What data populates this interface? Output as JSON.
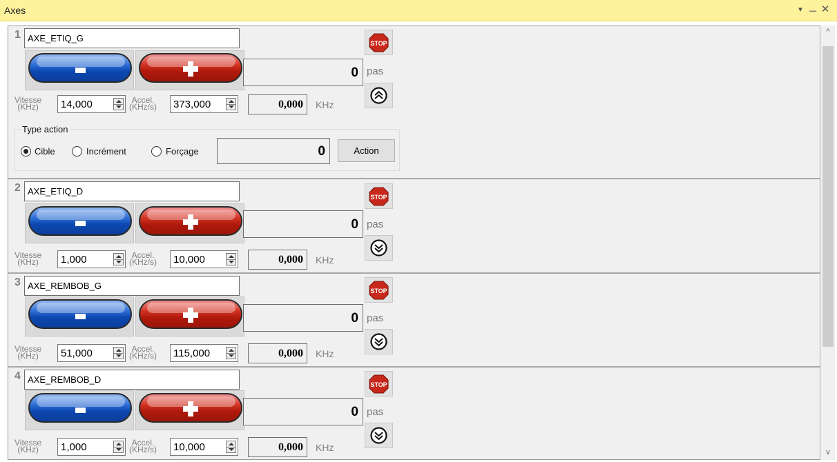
{
  "panel": {
    "title": "Axes",
    "menu_icon": "dropdown-triangle-icon",
    "pin_icon": "pin-icon",
    "close_icon": "close-icon",
    "scroll_up": "^",
    "scroll_down": "v"
  },
  "labels": {
    "vitesse": "Vitesse",
    "vitesse_unit": "(KHz)",
    "accel": "Accel.",
    "accel_unit": "(KHz/s)",
    "pas": "pas",
    "khz": "KHz",
    "stop": "STOP"
  },
  "colors": {
    "titlebar": "#fff29d",
    "minus_button": "#0c48b0",
    "plus_button": "#b01a0c",
    "stop_sign": "#c8281c"
  },
  "axes": [
    {
      "number": "1",
      "name": "AXE_ETIQ_G",
      "position": "0",
      "vitesse": "14,000",
      "accel": "373,000",
      "frequency": "0,000",
      "home_icon": "double-chevron-up-icon"
    },
    {
      "number": "2",
      "name": "AXE_ETIQ_D",
      "position": "0",
      "vitesse": "1,000",
      "accel": "10,000",
      "frequency": "0,000",
      "home_icon": "double-chevron-down-icon"
    },
    {
      "number": "3",
      "name": "AXE_REMBOB_G",
      "position": "0",
      "vitesse": "51,000",
      "accel": "115,000",
      "frequency": "0,000",
      "home_icon": "double-chevron-down-icon"
    },
    {
      "number": "4",
      "name": "AXE_REMBOB_D",
      "position": "0",
      "vitesse": "1,000",
      "accel": "10,000",
      "frequency": "0,000",
      "home_icon": "double-chevron-down-icon"
    }
  ],
  "type_action": {
    "title": "Type action",
    "options": [
      "Cible",
      "Incrément",
      "Forçage"
    ],
    "selected": "Cible",
    "value": "0",
    "button": "Action"
  }
}
